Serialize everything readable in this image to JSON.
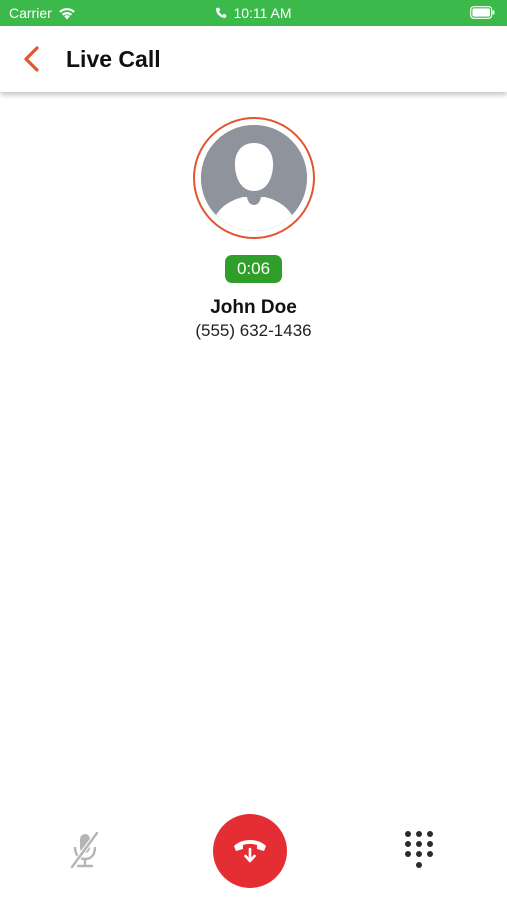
{
  "status_bar": {
    "carrier": "Carrier",
    "time": "10:11 AM",
    "wifi_icon": "wifi-icon",
    "phone_icon": "phone-icon",
    "battery_icon": "battery-icon",
    "background_color": "#3cb94b"
  },
  "nav": {
    "title": "Live Call",
    "back_icon": "chevron-left-icon",
    "accent_color": "#e0562e"
  },
  "call": {
    "avatar_icon": "person-placeholder-icon",
    "duration": "0:06",
    "contact_name": "John Doe",
    "phone_number": "(555) 632-1436",
    "timer_color": "#2f9e2b"
  },
  "controls": {
    "mute_icon": "microphone-muted-icon",
    "end_call_icon": "end-call-icon",
    "keypad_icon": "keypad-icon",
    "end_call_color": "#e52e33"
  }
}
